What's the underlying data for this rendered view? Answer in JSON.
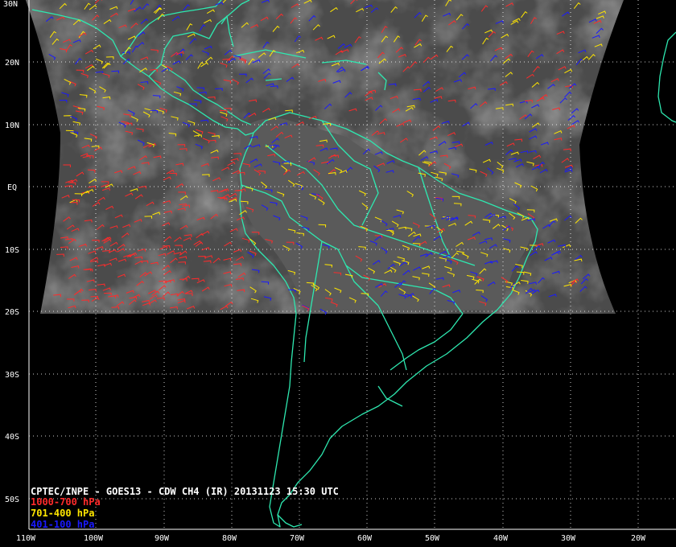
{
  "product_title": "CPTEC/INPE - GOES13 - CDW CH4 (IR) 20131123 15:30 UTC",
  "legend": [
    {
      "label": "1000-700 hPa",
      "color": "#ff2b2b"
    },
    {
      "label": "701-400 hPa",
      "color": "#ffe600"
    },
    {
      "label": "401-100 hPa",
      "color": "#1a1aff"
    }
  ],
  "lat_labels": [
    "30N",
    "20N",
    "10N",
    "EQ",
    "10S",
    "20S",
    "30S",
    "40S",
    "50S"
  ],
  "lon_labels": [
    "110W",
    "100W",
    "90W",
    "80W",
    "70W",
    "60W",
    "50W",
    "40W",
    "30W",
    "20W"
  ],
  "colors": {
    "coastline": "#2ee8b0",
    "grid": "#ffffff",
    "background": "#000000"
  }
}
